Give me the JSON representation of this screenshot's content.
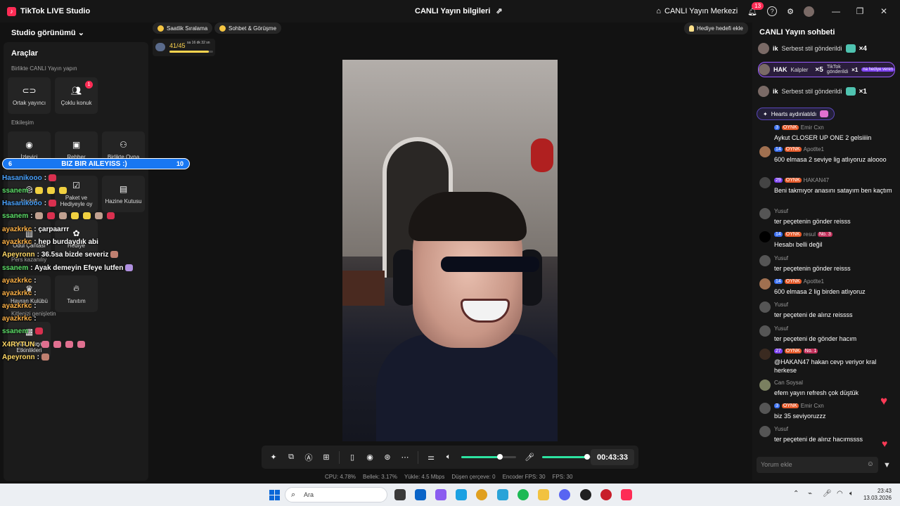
{
  "app": {
    "title": "TikTok LIVE Studio",
    "live_info_title": "CANLI Yayın bilgileri",
    "live_center_label": "CANLI Yayın Merkezi",
    "notifications_count": "13"
  },
  "left": {
    "studio_view_label": "Studio görünümü",
    "tools_title": "Araçlar",
    "section_together": "Birlikte CANLI Yayın yapın",
    "section_engagement": "Etkileşim",
    "section_expand": "Kitlenizi genişletin",
    "tiles": [
      {
        "label": "Ortak yayıncı",
        "icon": "link-icon"
      },
      {
        "label": "Çoklu konuk",
        "icon": "users-icon",
        "badge": "1"
      },
      {
        "label": "İzleyici",
        "icon": "viewer-icon"
      },
      {
        "label": "Rehber",
        "icon": "guide-icon"
      },
      {
        "label": "Birlikte Oyna",
        "icon": "play-together-icon"
      },
      {
        "label": "Hedefi",
        "icon": "target-icon"
      },
      {
        "label": "Paket ve Hediyeyle oy",
        "icon": "vote-icon"
      },
      {
        "label": "Hazine Kutusu",
        "icon": "treasure-icon"
      },
      {
        "label": "Ödül Çantası",
        "icon": "reward-icon"
      },
      {
        "label": "Hediye",
        "icon": "gift-icon"
      },
      {
        "label": "Hayran Kulübü",
        "icon": "fan-club-icon"
      },
      {
        "label": "Tanıtım",
        "icon": "fire-icon"
      },
      {
        "label": "CANLI Yayın Etkinlikleri",
        "icon": "events-icon"
      }
    ],
    "extra_label": "Pers kazanılıy"
  },
  "overlay": {
    "goal": {
      "left": "6",
      "text": "BIZ BIR AILEYISS :)",
      "right": "10"
    },
    "lines": [
      {
        "name": "Hasanikooo",
        "text": ":",
        "color": "blue"
      },
      {
        "name": "ssanem",
        "text": ":",
        "color": "green"
      },
      {
        "name": "Hasanikooo",
        "text": ":",
        "color": "blue"
      },
      {
        "name": "ssanem",
        "text": ":",
        "color": "green"
      },
      {
        "name": "ayazkrkc",
        "text": ": çarpaarrr",
        "color": "orange"
      },
      {
        "name": "ayazkrkc",
        "text": ": hep burdaydık abi",
        "color": "orange"
      },
      {
        "name": "Apeyronn",
        "text": ": 36.5sa bizde severiz",
        "color": "yellow"
      },
      {
        "name": "ssanem",
        "text": ": Ayak demeyin Efeye lutfen",
        "color": "green"
      },
      {
        "name": "ayazkrkc",
        "text": ":",
        "color": "orange"
      },
      {
        "name": "ayazkrkc",
        "text": ":",
        "color": "orange"
      },
      {
        "name": "ayazkrkc",
        "text": ":",
        "color": "orange"
      },
      {
        "name": "ayazkrkc",
        "text": ":",
        "color": "orange"
      },
      {
        "name": "ssanem",
        "text": ":",
        "color": "green"
      },
      {
        "name": "X4RYTUN",
        "text": ":",
        "color": "yellow"
      },
      {
        "name": "Apeyronn",
        "text": ":",
        "color": "yellow"
      }
    ]
  },
  "top": {
    "chip_hourly": "Saatlik Sıralama",
    "chip_chat": "Sohbet & Görüşme",
    "progress_value": "41/45",
    "progress_time": "sa 16 dk 32 sn",
    "progress_fraction": 0.91,
    "gift_goal_label": "Hediye hedefi ekle"
  },
  "controls": {
    "timer": "00:43:33",
    "speaker_level": 0.7,
    "mic_level": 0.82
  },
  "stats": [
    "CPU: 4.78%",
    "Bellek: 3.17%",
    "Yükle: 4.5 Mbps",
    "Düşen çerçeve: 0",
    "Encoder FPS: 30",
    "FPS: 30"
  ],
  "chat": {
    "title": "CANLI Yayın sohbeti",
    "gifts": [
      {
        "user": "ik",
        "text": "Serbest stil gönderildi",
        "mult": "×4"
      },
      {
        "user": "HAK",
        "text": "Kalpler",
        "mult": "×5",
        "sub": "TikTok gönderildi",
        "sub_mult": "×1",
        "tag": "na hediye veren"
      },
      {
        "user": "ik",
        "text": "Serbest stil gönderildi",
        "mult": "×1"
      }
    ],
    "hearts_label": "Hearts aydınlatıldı",
    "messages": [
      {
        "meta_user": "Emir Cxn",
        "lvl": "3",
        "tag": "OYNK",
        "body": "Aykut CLOSER UP ONE 2 gelsiiiin"
      },
      {
        "meta_user": "Apotlte1",
        "lvl": "14",
        "tag": "OYNK",
        "body": "600 elmasa 2 seviye lig atlıyoruz aloooo"
      },
      {
        "meta_user": "HAKAN47",
        "lvl": "29",
        "tag": "OYNK",
        "body": "Beni takmıyor anasını satayım ben kaçtım",
        "purple": true
      },
      {
        "meta_user": "Yusuf",
        "body": "ter peçetenin gönder reisss"
      },
      {
        "meta_user": "resul",
        "lvl": "14",
        "tag": "OYNK",
        "rank": "No. 3",
        "body": "Hesabı belli değil"
      },
      {
        "meta_user": "Yusuf",
        "body": "ter peçetenin gönder reisss"
      },
      {
        "meta_user": "Apotlte1",
        "lvl": "14",
        "tag": "OYNK",
        "body": "600 elmasa 2 lig birden atlıyoruz"
      },
      {
        "meta_user": "Yusuf",
        "body": "ter peçeteni de alınz reissss"
      },
      {
        "meta_user": "Yusuf",
        "body": "ter peçeteni de gönder hacım"
      },
      {
        "meta_user": "",
        "lvl": "27",
        "tag": "OYNK",
        "rank": "No. 1",
        "body": "@HAKAN47 hakan cevp veriyor kral herkese",
        "purple": true
      },
      {
        "meta_user": "Can Soysal",
        "body": "efem yayın refresh çok düştük"
      },
      {
        "meta_user": "Emir Cxn",
        "lvl": "3",
        "tag": "OYNK",
        "body": "biz 35 seviyoruzzz"
      },
      {
        "meta_user": "Yusuf",
        "body": "ter peçeteni de alınz hacımssss"
      }
    ],
    "input_placeholder": "Yorum ekle"
  },
  "taskbar": {
    "search_placeholder": "Ara",
    "time": "23:43",
    "date": "13.03.2026"
  }
}
